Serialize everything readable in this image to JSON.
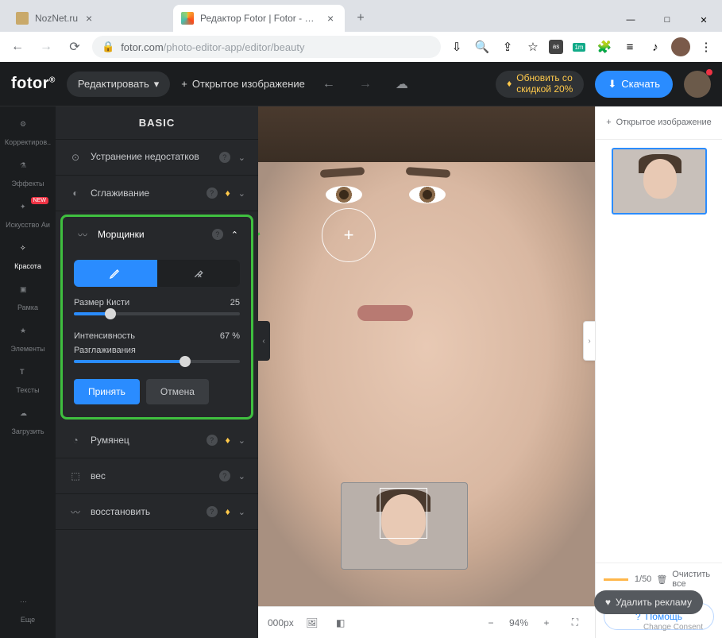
{
  "browser": {
    "tabs": [
      {
        "title": "NozNet.ru",
        "favicon": "#7a6a3a"
      },
      {
        "title": "Редактор Fotor | Fotor - онлай",
        "favicon": "linear-gradient(135deg,#f7b733,#fc4a1a,#4abdac)"
      }
    ],
    "url_host": "fotor.com",
    "url_path": "/photo-editor-app/editor/beauty",
    "window": {
      "min": "—",
      "max": "□",
      "close": "✕"
    }
  },
  "topbar": {
    "logo": "fotor",
    "edit": "Редактировать",
    "open": "Открытое изображение",
    "upgrade_l1": "Обновить со",
    "upgrade_l2": "скидкой 20%",
    "download": "Скачать"
  },
  "rail": [
    {
      "id": "adjust",
      "label": "Корректиров.."
    },
    {
      "id": "effects",
      "label": "Эффекты"
    },
    {
      "id": "ai",
      "label": "Искусство Аи",
      "new": "NEW"
    },
    {
      "id": "beauty",
      "label": "Красота",
      "active": true
    },
    {
      "id": "frame",
      "label": "Рамка"
    },
    {
      "id": "elements",
      "label": "Элементы"
    },
    {
      "id": "text",
      "label": "Тексты"
    },
    {
      "id": "upload",
      "label": "Загрузить"
    },
    {
      "id": "more",
      "label": "Еще"
    }
  ],
  "panel": {
    "title": "BASIC",
    "items": {
      "blemish": {
        "label": "Устранение недостатков"
      },
      "smooth": {
        "label": "Сглаживание"
      },
      "wrinkles": {
        "label": "Морщинки"
      },
      "blush": {
        "label": "Румянец"
      },
      "weight": {
        "label": "вес"
      },
      "restore": {
        "label": "восстановить"
      }
    },
    "brush_label": "Размер Кисти",
    "brush_value": "25",
    "intensity_label": "Интенсивность",
    "intensity_value": "67 %",
    "smooth_label": "Разглаживания",
    "apply": "Принять",
    "cancel": "Отмена"
  },
  "status": {
    "dims": "000px",
    "zoom": "94%"
  },
  "rpanel": {
    "open": "Открытое изображение",
    "page": "1/50",
    "clear": "Очистить все",
    "help": "Помощь"
  },
  "overlay": {
    "remove_ads": "Удалить рекламу",
    "consent": "Change Consent"
  }
}
